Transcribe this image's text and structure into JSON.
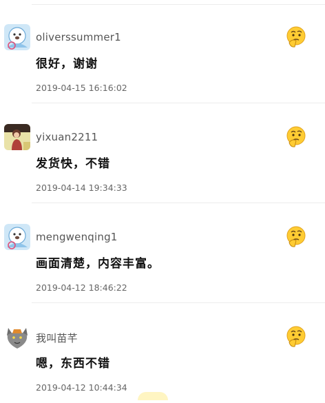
{
  "comments": [
    {
      "username": "oliverssummer1",
      "text": "很好，谢谢",
      "time": "2019-04-15 16:16:02",
      "avatar": "seal-avatar",
      "emoji": "thinking-face-icon"
    },
    {
      "username": "yixuan2211",
      "text": "发货快，不错",
      "time": "2019-04-14 19:34:33",
      "avatar": "photo-avatar",
      "emoji": "thinking-face-icon"
    },
    {
      "username": "mengwenqing1",
      "text": "画面清楚，内容丰富。",
      "time": "2019-04-12 18:46:22",
      "avatar": "seal-avatar",
      "emoji": "thinking-face-icon"
    },
    {
      "username": "我叫苗芊",
      "text": "嗯，东西不错",
      "time": "2019-04-12 10:44:34",
      "avatar": "wolf-avatar",
      "emoji": "thinking-face-icon"
    }
  ],
  "colors": {
    "username": "#555555",
    "time": "#666666",
    "divider": "#ececec",
    "emoji": "#ffcc33"
  }
}
